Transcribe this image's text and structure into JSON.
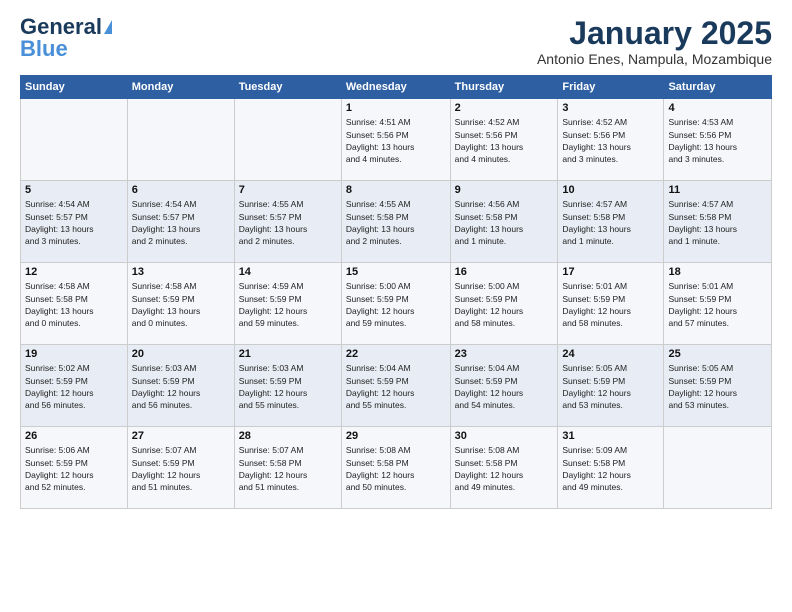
{
  "header": {
    "logo_line1": "General",
    "logo_line2": "Blue",
    "title": "January 2025",
    "location": "Antonio Enes, Nampula, Mozambique"
  },
  "days_of_week": [
    "Sunday",
    "Monday",
    "Tuesday",
    "Wednesday",
    "Thursday",
    "Friday",
    "Saturday"
  ],
  "weeks": [
    [
      {
        "num": "",
        "info": ""
      },
      {
        "num": "",
        "info": ""
      },
      {
        "num": "",
        "info": ""
      },
      {
        "num": "1",
        "info": "Sunrise: 4:51 AM\nSunset: 5:56 PM\nDaylight: 13 hours\nand 4 minutes."
      },
      {
        "num": "2",
        "info": "Sunrise: 4:52 AM\nSunset: 5:56 PM\nDaylight: 13 hours\nand 4 minutes."
      },
      {
        "num": "3",
        "info": "Sunrise: 4:52 AM\nSunset: 5:56 PM\nDaylight: 13 hours\nand 3 minutes."
      },
      {
        "num": "4",
        "info": "Sunrise: 4:53 AM\nSunset: 5:56 PM\nDaylight: 13 hours\nand 3 minutes."
      }
    ],
    [
      {
        "num": "5",
        "info": "Sunrise: 4:54 AM\nSunset: 5:57 PM\nDaylight: 13 hours\nand 3 minutes."
      },
      {
        "num": "6",
        "info": "Sunrise: 4:54 AM\nSunset: 5:57 PM\nDaylight: 13 hours\nand 2 minutes."
      },
      {
        "num": "7",
        "info": "Sunrise: 4:55 AM\nSunset: 5:57 PM\nDaylight: 13 hours\nand 2 minutes."
      },
      {
        "num": "8",
        "info": "Sunrise: 4:55 AM\nSunset: 5:58 PM\nDaylight: 13 hours\nand 2 minutes."
      },
      {
        "num": "9",
        "info": "Sunrise: 4:56 AM\nSunset: 5:58 PM\nDaylight: 13 hours\nand 1 minute."
      },
      {
        "num": "10",
        "info": "Sunrise: 4:57 AM\nSunset: 5:58 PM\nDaylight: 13 hours\nand 1 minute."
      },
      {
        "num": "11",
        "info": "Sunrise: 4:57 AM\nSunset: 5:58 PM\nDaylight: 13 hours\nand 1 minute."
      }
    ],
    [
      {
        "num": "12",
        "info": "Sunrise: 4:58 AM\nSunset: 5:58 PM\nDaylight: 13 hours\nand 0 minutes."
      },
      {
        "num": "13",
        "info": "Sunrise: 4:58 AM\nSunset: 5:59 PM\nDaylight: 13 hours\nand 0 minutes."
      },
      {
        "num": "14",
        "info": "Sunrise: 4:59 AM\nSunset: 5:59 PM\nDaylight: 12 hours\nand 59 minutes."
      },
      {
        "num": "15",
        "info": "Sunrise: 5:00 AM\nSunset: 5:59 PM\nDaylight: 12 hours\nand 59 minutes."
      },
      {
        "num": "16",
        "info": "Sunrise: 5:00 AM\nSunset: 5:59 PM\nDaylight: 12 hours\nand 58 minutes."
      },
      {
        "num": "17",
        "info": "Sunrise: 5:01 AM\nSunset: 5:59 PM\nDaylight: 12 hours\nand 58 minutes."
      },
      {
        "num": "18",
        "info": "Sunrise: 5:01 AM\nSunset: 5:59 PM\nDaylight: 12 hours\nand 57 minutes."
      }
    ],
    [
      {
        "num": "19",
        "info": "Sunrise: 5:02 AM\nSunset: 5:59 PM\nDaylight: 12 hours\nand 56 minutes."
      },
      {
        "num": "20",
        "info": "Sunrise: 5:03 AM\nSunset: 5:59 PM\nDaylight: 12 hours\nand 56 minutes."
      },
      {
        "num": "21",
        "info": "Sunrise: 5:03 AM\nSunset: 5:59 PM\nDaylight: 12 hours\nand 55 minutes."
      },
      {
        "num": "22",
        "info": "Sunrise: 5:04 AM\nSunset: 5:59 PM\nDaylight: 12 hours\nand 55 minutes."
      },
      {
        "num": "23",
        "info": "Sunrise: 5:04 AM\nSunset: 5:59 PM\nDaylight: 12 hours\nand 54 minutes."
      },
      {
        "num": "24",
        "info": "Sunrise: 5:05 AM\nSunset: 5:59 PM\nDaylight: 12 hours\nand 53 minutes."
      },
      {
        "num": "25",
        "info": "Sunrise: 5:05 AM\nSunset: 5:59 PM\nDaylight: 12 hours\nand 53 minutes."
      }
    ],
    [
      {
        "num": "26",
        "info": "Sunrise: 5:06 AM\nSunset: 5:59 PM\nDaylight: 12 hours\nand 52 minutes."
      },
      {
        "num": "27",
        "info": "Sunrise: 5:07 AM\nSunset: 5:59 PM\nDaylight: 12 hours\nand 51 minutes."
      },
      {
        "num": "28",
        "info": "Sunrise: 5:07 AM\nSunset: 5:58 PM\nDaylight: 12 hours\nand 51 minutes."
      },
      {
        "num": "29",
        "info": "Sunrise: 5:08 AM\nSunset: 5:58 PM\nDaylight: 12 hours\nand 50 minutes."
      },
      {
        "num": "30",
        "info": "Sunrise: 5:08 AM\nSunset: 5:58 PM\nDaylight: 12 hours\nand 49 minutes."
      },
      {
        "num": "31",
        "info": "Sunrise: 5:09 AM\nSunset: 5:58 PM\nDaylight: 12 hours\nand 49 minutes."
      },
      {
        "num": "",
        "info": ""
      }
    ]
  ]
}
